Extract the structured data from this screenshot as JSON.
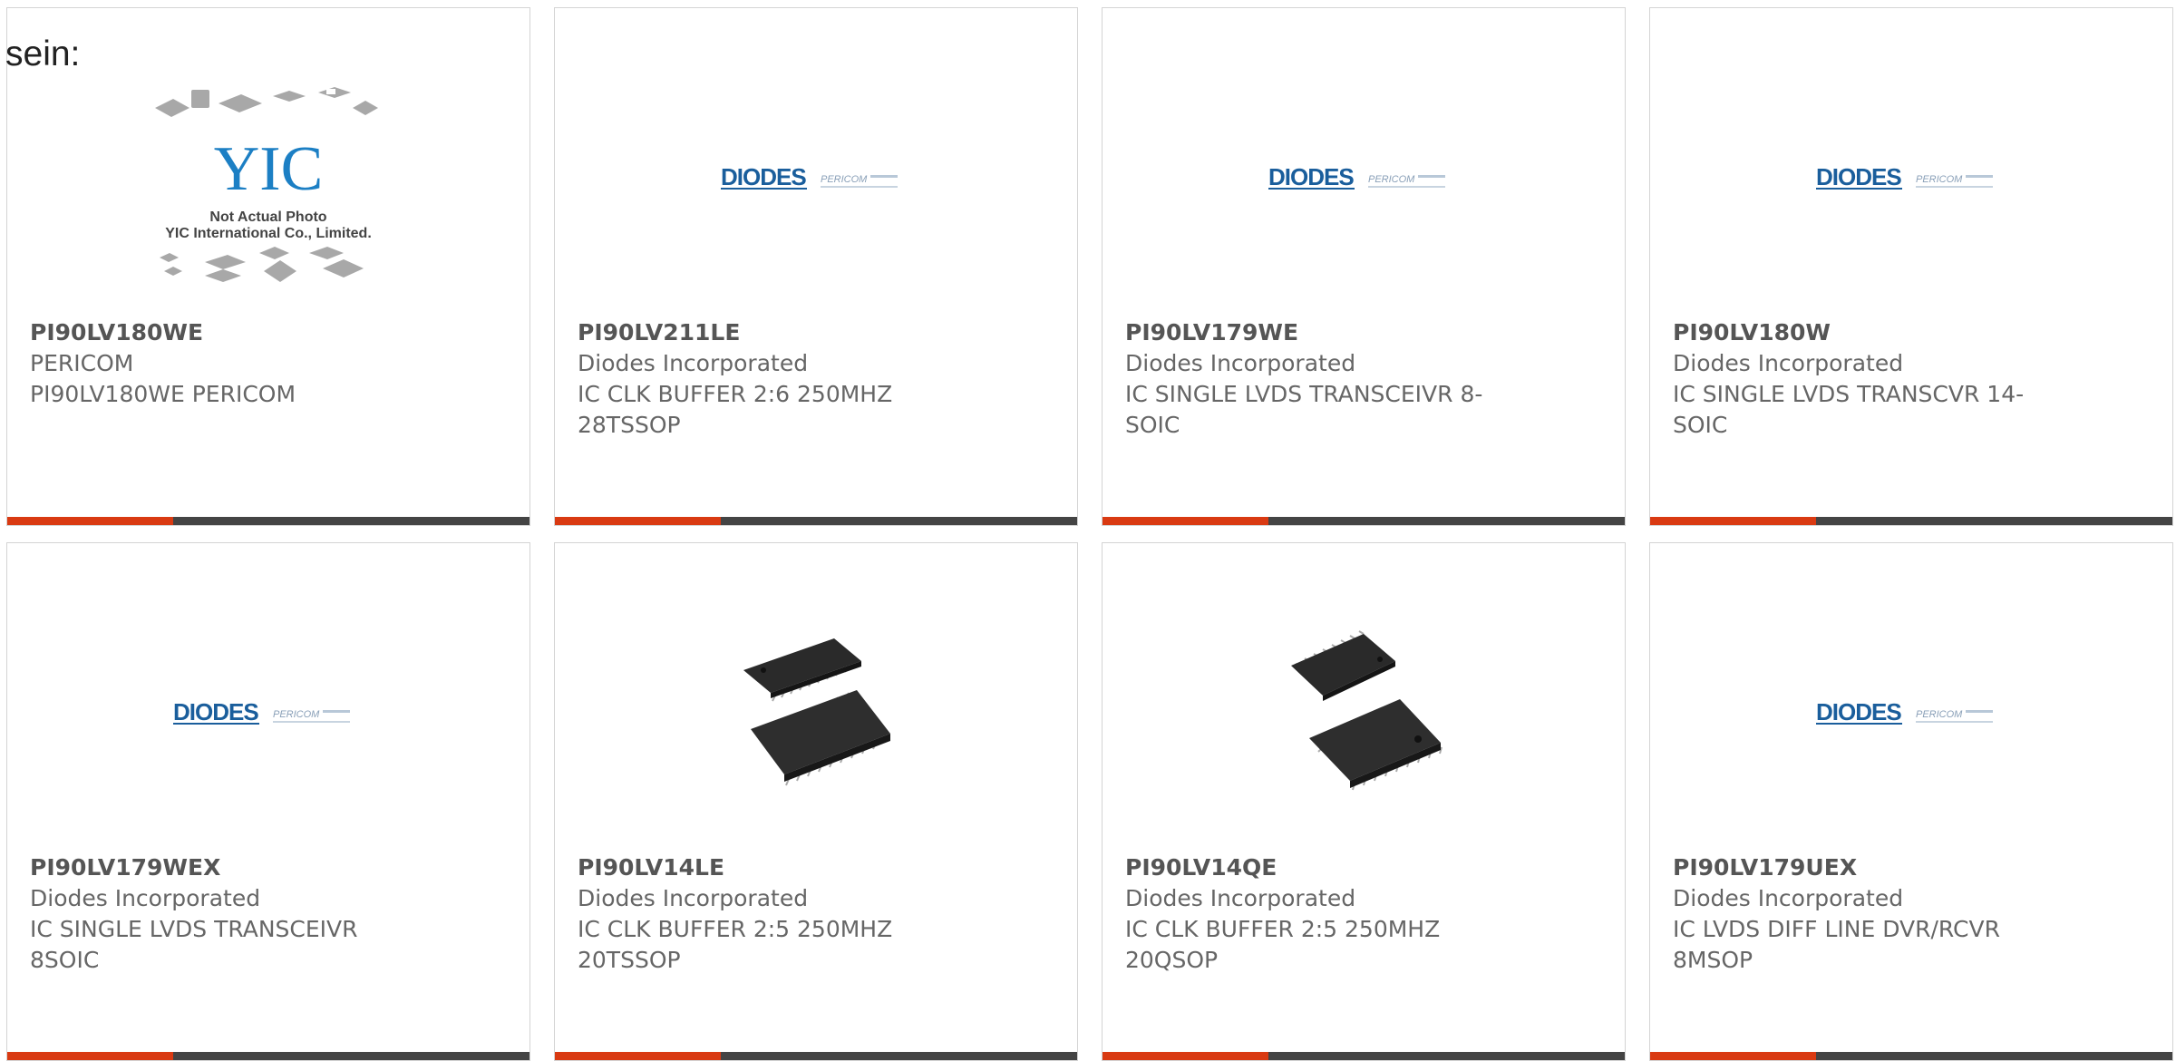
{
  "prefix_text": "sein:",
  "colors": {
    "accent": "#d93a12",
    "bar": "#444444",
    "diodes_blue": "#1a5e9c",
    "pericom_gray": "#8aa0b8"
  },
  "placeholder": {
    "line1": "Not Actual Photo",
    "line2": "YIC International Co., Limited.",
    "mark": "YIC"
  },
  "logo_text": {
    "diodes": "DIODES",
    "pericom": "PERICOM"
  },
  "products": [
    {
      "part": "PI90LV180WE",
      "maker": "PERICOM",
      "desc1": "PI90LV180WE PERICOM",
      "desc2": "",
      "image": "yic-placeholder"
    },
    {
      "part": "PI90LV211LE",
      "maker": "Diodes Incorporated",
      "desc1": "IC CLK BUFFER 2:6 250MHZ",
      "desc2": "28TSSOP",
      "image": "diodes-pericom-logo"
    },
    {
      "part": "PI90LV179WE",
      "maker": "Diodes Incorporated",
      "desc1": "IC SINGLE LVDS TRANSCEIVR 8-",
      "desc2": "SOIC",
      "image": "diodes-pericom-logo"
    },
    {
      "part": "PI90LV180W",
      "maker": "Diodes Incorporated",
      "desc1": "IC SINGLE LVDS TRANSCVR 14-",
      "desc2": "SOIC",
      "image": "diodes-pericom-logo"
    },
    {
      "part": "PI90LV179WEX",
      "maker": "Diodes Incorporated",
      "desc1": "IC SINGLE LVDS TRANSCEIVR",
      "desc2": "8SOIC",
      "image": "diodes-pericom-logo"
    },
    {
      "part": "PI90LV14LE",
      "maker": "Diodes Incorporated",
      "desc1": "IC CLK BUFFER 2:5 250MHZ",
      "desc2": "20TSSOP",
      "image": "ic-chip-photo"
    },
    {
      "part": "PI90LV14QE",
      "maker": "Diodes Incorporated",
      "desc1": "IC CLK BUFFER 2:5 250MHZ",
      "desc2": "20QSOP",
      "image": "ic-chip-photo"
    },
    {
      "part": "PI90LV179UEX",
      "maker": "Diodes Incorporated",
      "desc1": "IC LVDS DIFF LINE DVR/RCVR",
      "desc2": "8MSOP",
      "image": "diodes-pericom-logo"
    }
  ]
}
